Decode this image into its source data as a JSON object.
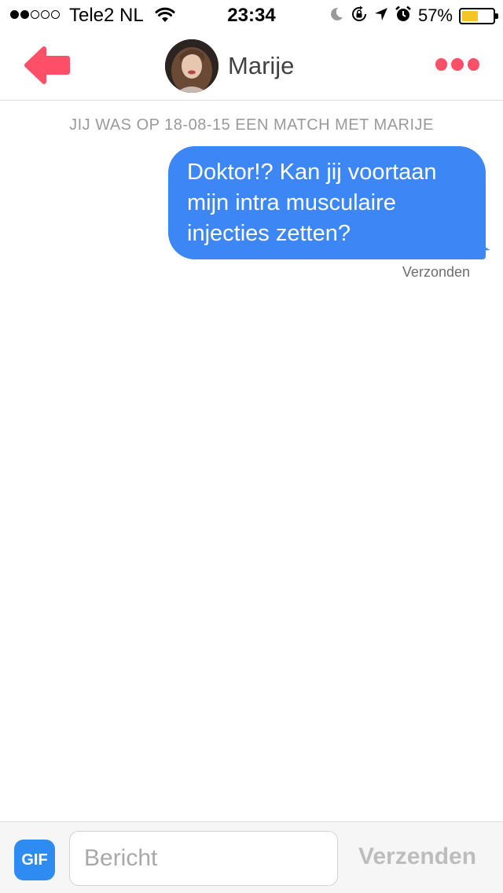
{
  "status_bar": {
    "signal_bars_filled": 2,
    "signal_bars_total": 5,
    "carrier": "Tele2 NL",
    "time": "23:34",
    "battery_percent": "57%",
    "battery_level": 0.57,
    "battery_color": "#f5c623",
    "icons": [
      "wifi-icon",
      "moon-icon",
      "rotation-lock-icon",
      "location-icon",
      "alarm-icon"
    ]
  },
  "header": {
    "back_icon": "back-arrow-icon",
    "match_name": "Marije",
    "more_icon": "more-dots-icon",
    "accent_color": "#fd5068"
  },
  "conversation": {
    "match_notice": "JIJ WAS OP 18-08-15 EEN MATCH MET MARIJE",
    "messages": [
      {
        "text": "Doktor!? Kan jij voortaan mijn intra musculaire injecties zetten?",
        "status": "Verzonden",
        "bubble_color": "#3d86f5"
      }
    ]
  },
  "input_bar": {
    "gif_label": "GIF",
    "placeholder": "Bericht",
    "value": "",
    "send_label": "Verzenden"
  }
}
